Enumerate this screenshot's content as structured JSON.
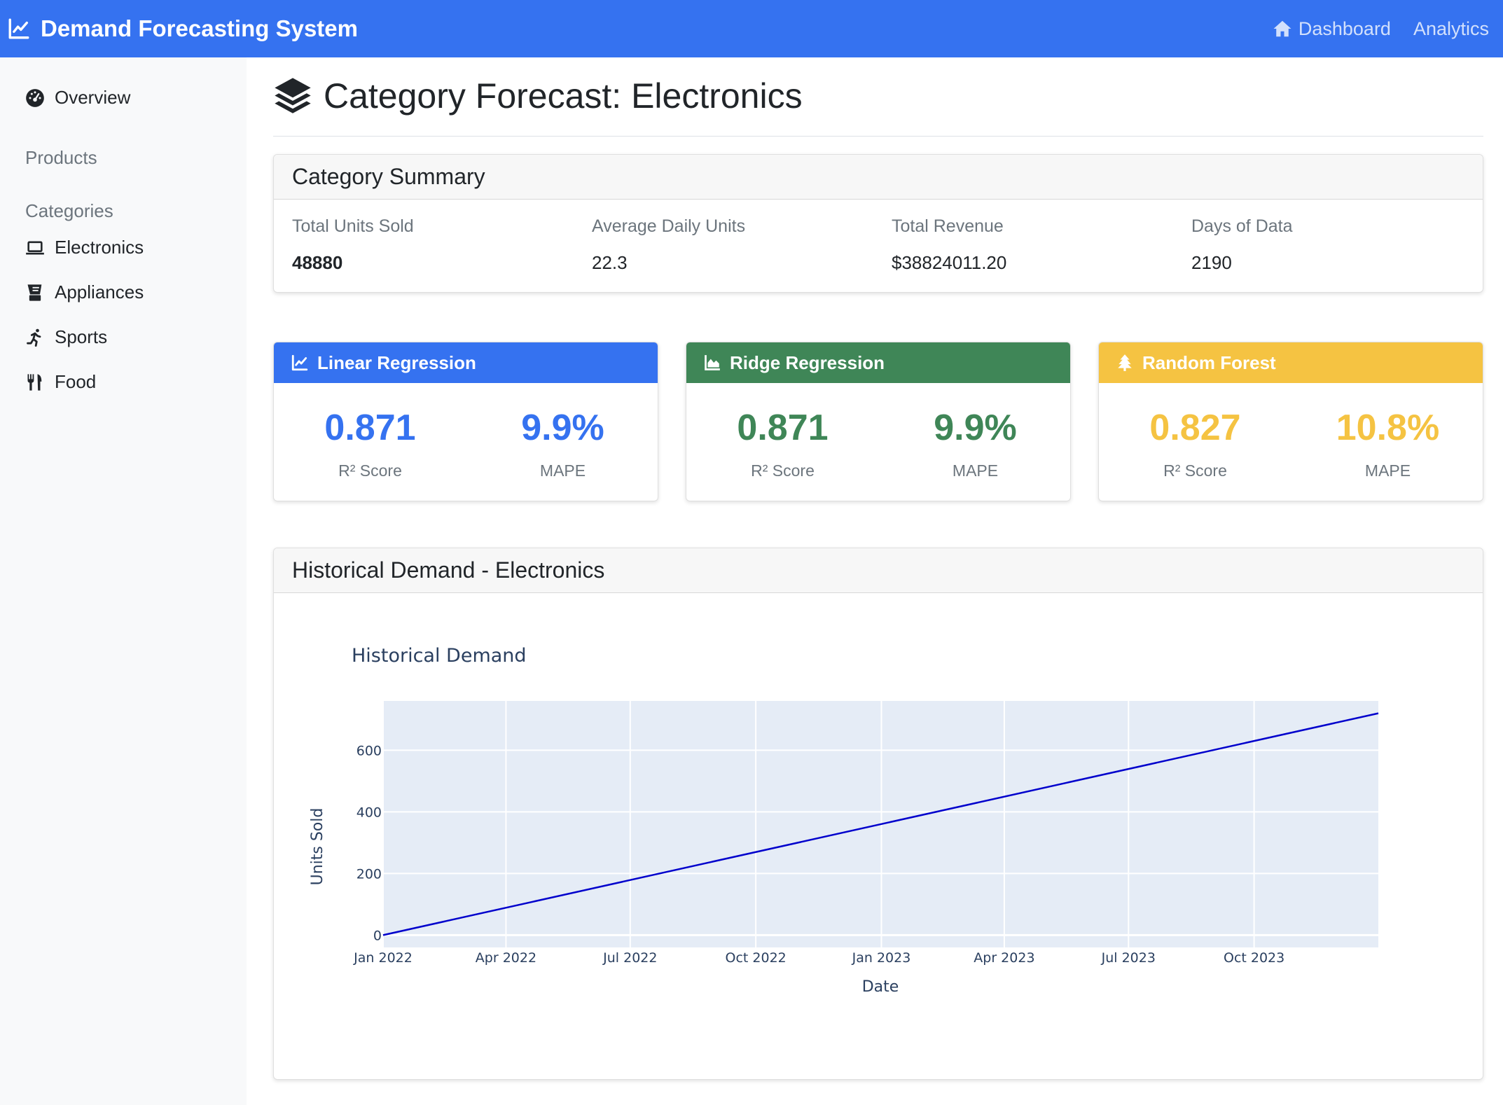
{
  "navbar": {
    "brand": "Demand Forecasting System",
    "links": [
      {
        "label": "Dashboard",
        "icon": "home-icon"
      },
      {
        "label": "Analytics"
      }
    ]
  },
  "sidebar": {
    "overview": "Overview",
    "products_heading": "Products",
    "categories_heading": "Categories",
    "categories": [
      {
        "label": "Electronics",
        "icon": "laptop-icon"
      },
      {
        "label": "Appliances",
        "icon": "blender-icon"
      },
      {
        "label": "Sports",
        "icon": "running-icon"
      },
      {
        "label": "Food",
        "icon": "utensils-icon"
      }
    ]
  },
  "page": {
    "title": "Category Forecast: Electronics"
  },
  "summary": {
    "header": "Category Summary",
    "stats": [
      {
        "label": "Total Units Sold",
        "value": "48880"
      },
      {
        "label": "Average Daily Units",
        "value": "22.3"
      },
      {
        "label": "Total Revenue",
        "value": "$38824011.20"
      },
      {
        "label": "Days of Data",
        "value": "2190"
      }
    ]
  },
  "models": [
    {
      "name": "Linear Regression",
      "icon": "chart-line-icon",
      "color": "#3572f0",
      "r2": "0.871",
      "r2_label": "R² Score",
      "mape": "9.9%",
      "mape_label": "MAPE"
    },
    {
      "name": "Ridge Regression",
      "icon": "chart-area-icon",
      "color": "#3f8657",
      "r2": "0.871",
      "r2_label": "R² Score",
      "mape": "9.9%",
      "mape_label": "MAPE"
    },
    {
      "name": "Random Forest",
      "icon": "tree-icon",
      "color": "#f5c342",
      "r2": "0.827",
      "r2_label": "R² Score",
      "mape": "10.8%",
      "mape_label": "MAPE"
    }
  ],
  "chart_card": {
    "header": "Historical Demand - Electronics"
  },
  "chart_data": {
    "type": "line",
    "title": "Historical Demand",
    "xlabel": "Date",
    "ylabel": "Units Sold",
    "x_ticks": [
      "Jan 2022",
      "Apr 2022",
      "Jul 2022",
      "Oct 2022",
      "Jan 2023",
      "Apr 2023",
      "Jul 2023",
      "Oct 2023"
    ],
    "y_ticks": [
      0,
      200,
      400,
      600
    ],
    "xlim": [
      "2022-01-01",
      "2023-12-31"
    ],
    "ylim": [
      -40,
      760
    ],
    "series": [
      {
        "color": "#0000cc",
        "x": [
          "2022-01-01",
          "2023-12-31"
        ],
        "y": [
          0,
          720
        ]
      }
    ],
    "grid": true
  }
}
